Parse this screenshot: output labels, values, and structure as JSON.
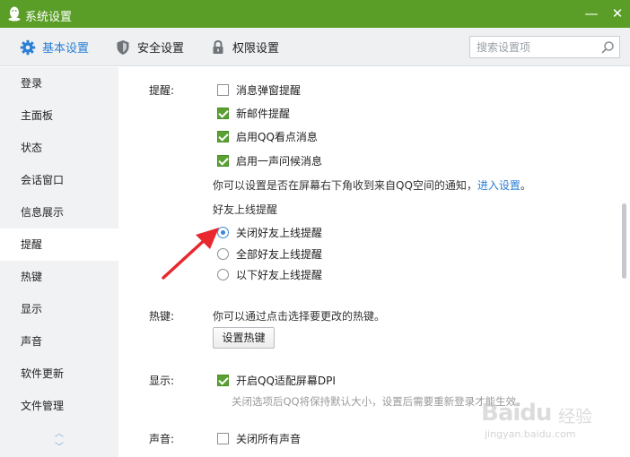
{
  "window": {
    "title": "系统设置",
    "minimize_label": "—",
    "close_label": "✕"
  },
  "tabs": [
    {
      "label": "基本设置",
      "icon": "gear-icon"
    },
    {
      "label": "安全设置",
      "icon": "shield-icon"
    },
    {
      "label": "权限设置",
      "icon": "lock-icon"
    }
  ],
  "search": {
    "placeholder": "搜索设置项"
  },
  "sidebar": {
    "items": [
      {
        "label": "登录"
      },
      {
        "label": "主面板"
      },
      {
        "label": "状态"
      },
      {
        "label": "会话窗口"
      },
      {
        "label": "信息展示"
      },
      {
        "label": "提醒"
      },
      {
        "label": "热键"
      },
      {
        "label": "显示"
      },
      {
        "label": "声音"
      },
      {
        "label": "软件更新"
      },
      {
        "label": "文件管理"
      }
    ],
    "active": "提醒"
  },
  "reminder": {
    "label": "提醒:",
    "options": [
      {
        "label": "消息弹窗提醒",
        "checked": false
      },
      {
        "label": "新邮件提醒",
        "checked": true
      },
      {
        "label": "启用QQ看点消息",
        "checked": true
      },
      {
        "label": "启用一声问候消息",
        "checked": true
      }
    ],
    "desc": "你可以设置是否在屏幕右下角收到来自QQ空间的通知，",
    "link": "进入设置",
    "desc_end": "。",
    "friend_online": {
      "title": "好友上线提醒",
      "radios": [
        {
          "label": "关闭好友上线提醒",
          "selected": true
        },
        {
          "label": "全部好友上线提醒",
          "selected": false
        },
        {
          "label": "以下好友上线提醒",
          "selected": false
        }
      ]
    }
  },
  "hotkey": {
    "label": "热键:",
    "desc": "你可以通过点击选择要更改的热键。",
    "button": "设置热键"
  },
  "display": {
    "label": "显示:",
    "option": {
      "label": "开启QQ适配屏幕DPI",
      "checked": true
    },
    "note": "关闭选项后QQ将保持默认大小，设置后需要重新登录才能生效。"
  },
  "sound": {
    "label": "声音:",
    "option": {
      "label": "关闭所有声音",
      "checked": false
    }
  },
  "watermark": {
    "logo": "Baidu",
    "jingyan": "经验",
    "url": "jingyan.baidu.com"
  },
  "colors": {
    "titlebar": "#5a9e28",
    "accent": "#2a7fd4",
    "check": "#5aa033",
    "arrow": "#e8282e"
  }
}
